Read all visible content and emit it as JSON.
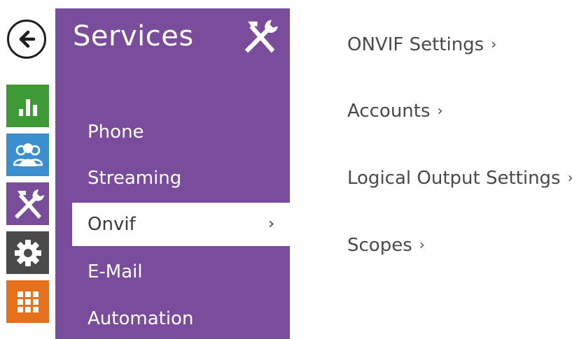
{
  "back_button": {
    "icon": "arrow-left-icon"
  },
  "rail": {
    "items": [
      {
        "icon": "bar-chart-icon",
        "color": "#3d9a35"
      },
      {
        "icon": "users-icon",
        "color": "#3b8fcf"
      },
      {
        "icon": "tools-icon",
        "color": "#7a4c9c"
      },
      {
        "icon": "gear-icon",
        "color": "#4a4a4a"
      },
      {
        "icon": "grid-icon",
        "color": "#e5711c"
      }
    ]
  },
  "panel": {
    "title": "Services",
    "icon": "tools-icon",
    "color": "#7a4c9c",
    "items": [
      {
        "label": "Phone"
      },
      {
        "label": "Streaming"
      },
      {
        "label": "Onvif",
        "active": true,
        "chevron": "›"
      },
      {
        "label": "E-Mail"
      },
      {
        "label": "Automation"
      }
    ]
  },
  "settings": {
    "links": [
      {
        "label": "ONVIF Settings",
        "chevron": "›"
      },
      {
        "label": "Accounts",
        "chevron": "›"
      },
      {
        "label": "Logical Output Settings",
        "chevron": "›"
      },
      {
        "label": "Scopes",
        "chevron": "›"
      }
    ]
  }
}
